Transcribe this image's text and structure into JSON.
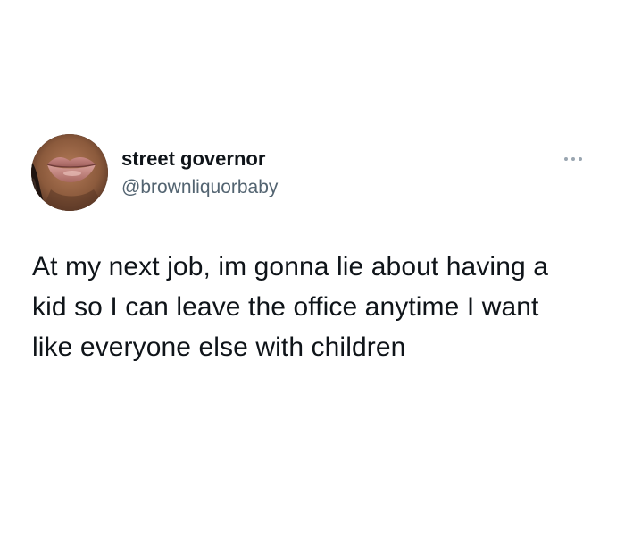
{
  "tweet": {
    "author": {
      "display_name": "street governor",
      "handle": "@brownliquorbaby",
      "avatar_icon": "profile-photo-lips"
    },
    "more_icon": "more-options-icon",
    "text": "At my next job, im gonna lie about having a kid so I can leave the office anytime I want like everyone else with children"
  },
  "colors": {
    "background": "#ffffff",
    "primary_text": "#0f1419",
    "secondary_text": "#536471",
    "icon": "#9aa6b1"
  }
}
